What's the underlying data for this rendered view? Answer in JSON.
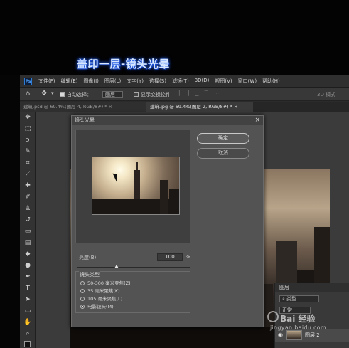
{
  "caption": "盖印一层-镜头光晕",
  "menu": [
    "文件(F)",
    "编辑(E)",
    "图像(I)",
    "图层(L)",
    "文字(Y)",
    "选择(S)",
    "滤镜(T)",
    "3D(D)",
    "视图(V)",
    "窗口(W)",
    "帮助(H)"
  ],
  "options": {
    "auto_select_label": "自动选择：",
    "auto_select_value": "图层",
    "show_transform_label": "显示变换控件",
    "mode_3d": "3D 模式"
  },
  "tabs": [
    {
      "label": "建筑.psd @ 69.4%(图层 4, RGB/8#) *",
      "close": "×"
    },
    {
      "label": "建筑.jpg @ 69.4%(图层 2, RGB/8#) *",
      "close": "×"
    }
  ],
  "dialog": {
    "title": "镜头光晕",
    "close": "×",
    "ok": "确定",
    "cancel": "取消",
    "brightness_label": "亮度(B):",
    "brightness_value": "100",
    "brightness_unit": "%",
    "lens_type_label": "镜头类型",
    "lens_options": [
      {
        "label": "50-300 毫米变焦(Z)",
        "selected": false
      },
      {
        "label": "35 毫米聚焦(K)",
        "selected": false
      },
      {
        "label": "105 毫米聚焦(L)",
        "selected": false
      },
      {
        "label": "电影镜头(M)",
        "selected": true
      }
    ]
  },
  "layers_panel": {
    "title": "图层",
    "filter": "类型",
    "blend": "正常",
    "layer_name": "图层 2"
  },
  "watermark": {
    "text": "Bai 经验",
    "url": "jingyan.baidu.com"
  }
}
